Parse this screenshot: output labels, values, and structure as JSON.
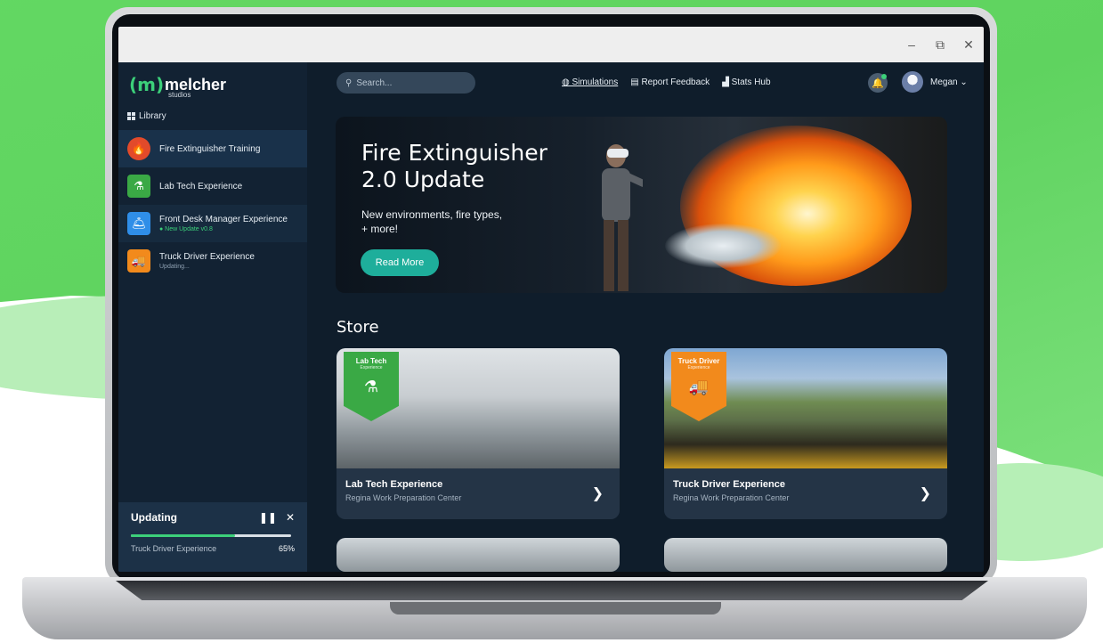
{
  "window": {
    "min": "–",
    "max": "⧉",
    "close": "✕"
  },
  "brand": {
    "name": "melcher",
    "sub": "studios"
  },
  "sidebar": {
    "library_label": "Library",
    "items": [
      {
        "label": "Fire Extinguisher Training",
        "sub": "",
        "color": "#e24a2a",
        "icon": "fire-icon"
      },
      {
        "label": "Lab Tech Experience",
        "sub": "",
        "color": "#3aa945",
        "icon": "flask-icon"
      },
      {
        "label": "Front Desk Manager Experience",
        "sub": "● New Update v0.8",
        "color": "#2f8ee8",
        "icon": "desk-icon"
      },
      {
        "label": "Truck Driver Experience",
        "sub": "Updating...",
        "color": "#f28a1c",
        "icon": "truck-icon"
      }
    ]
  },
  "updating": {
    "title": "Updating",
    "item": "Truck Driver Experience",
    "progress_label": "65%",
    "progress": 0.65
  },
  "topnav": {
    "search_placeholder": "Search...",
    "links": [
      "Simulations",
      "Report Feedback",
      "Stats Hub"
    ],
    "user": "Megan"
  },
  "hero": {
    "title_line1": "Fire Extinguisher",
    "title_line2": "2.0 Update",
    "desc_line1": "New environments, fire types,",
    "desc_line2": "+ more!",
    "button": "Read More"
  },
  "store": {
    "title": "Store",
    "cards": [
      {
        "name": "Lab Tech Experience",
        "sub": "Regina Work Preparation Center",
        "badge": "Lab Tech",
        "badge_sub": "Experience",
        "color": "#3aa945"
      },
      {
        "name": "Truck Driver Experience",
        "sub": "Regina Work Preparation Center",
        "badge": "Truck Driver",
        "badge_sub": "Experience",
        "color": "#f28a1c"
      }
    ]
  }
}
